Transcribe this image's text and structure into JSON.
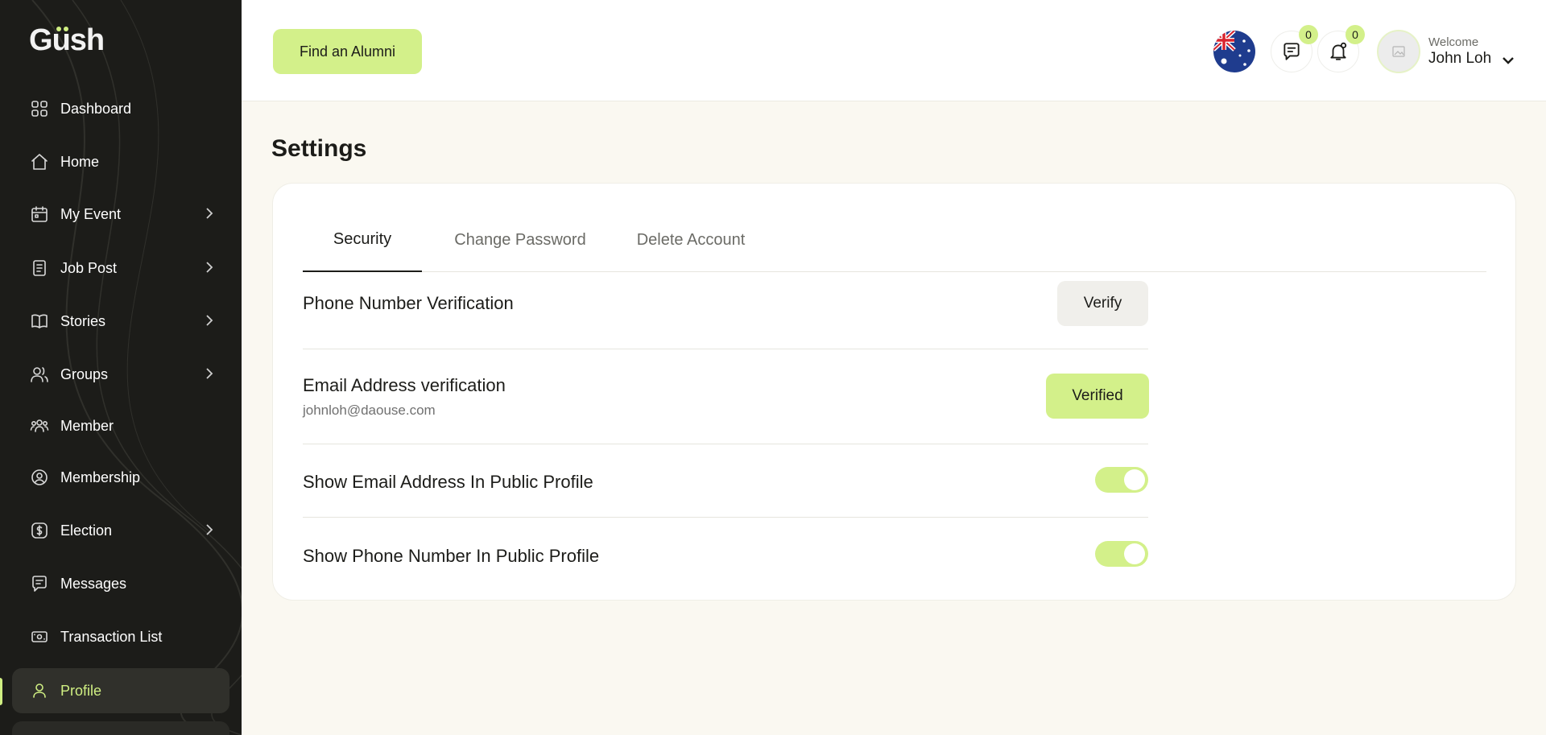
{
  "app": {
    "logo_text": "Gush"
  },
  "sidebar": {
    "items": [
      {
        "label": "Dashboard",
        "icon": "grid-icon",
        "has_chevron": false,
        "active": false
      },
      {
        "label": "Home",
        "icon": "home-icon",
        "has_chevron": false,
        "active": false
      },
      {
        "label": "My Event",
        "icon": "calendar-icon",
        "has_chevron": true,
        "active": false
      },
      {
        "label": "Job Post",
        "icon": "document-icon",
        "has_chevron": true,
        "active": false
      },
      {
        "label": "Stories",
        "icon": "book-icon",
        "has_chevron": true,
        "active": false
      },
      {
        "label": "Groups",
        "icon": "users-icon",
        "has_chevron": true,
        "active": false
      },
      {
        "label": "Member",
        "icon": "members-icon",
        "has_chevron": false,
        "active": false
      },
      {
        "label": "Membership",
        "icon": "membership-icon",
        "has_chevron": false,
        "active": false
      },
      {
        "label": "Election",
        "icon": "dollar-icon",
        "has_chevron": true,
        "active": false
      },
      {
        "label": "Messages",
        "icon": "message-icon",
        "has_chevron": false,
        "active": false
      },
      {
        "label": "Transaction List",
        "icon": "cash-icon",
        "has_chevron": false,
        "active": false
      },
      {
        "label": "Profile",
        "icon": "user-icon",
        "has_chevron": false,
        "active": true
      }
    ]
  },
  "header": {
    "find_button": "Find an Alumni",
    "flag_icon": "australia-flag-icon",
    "messages_count": "0",
    "notifications_count": "0",
    "welcome": "Welcome",
    "user_name": "John Loh"
  },
  "settings": {
    "title": "Settings",
    "tabs": [
      {
        "label": "Security",
        "active": true
      },
      {
        "label": "Change Password",
        "active": false
      },
      {
        "label": "Delete Account",
        "active": false
      }
    ],
    "phone_verification": {
      "label": "Phone Number Verification",
      "button": "Verify"
    },
    "email_verification": {
      "label": "Email Address verification",
      "email": "johnloh@daouse.com",
      "button": "Verified"
    },
    "show_email": {
      "label": "Show Email Address In Public Profile",
      "enabled": true
    },
    "show_phone": {
      "label": "Show Phone Number In Public Profile",
      "enabled": true
    }
  },
  "colors": {
    "accent": "#d3f08a",
    "sidebar_bg": "#1c1c19",
    "page_bg": "#faf8f1"
  }
}
